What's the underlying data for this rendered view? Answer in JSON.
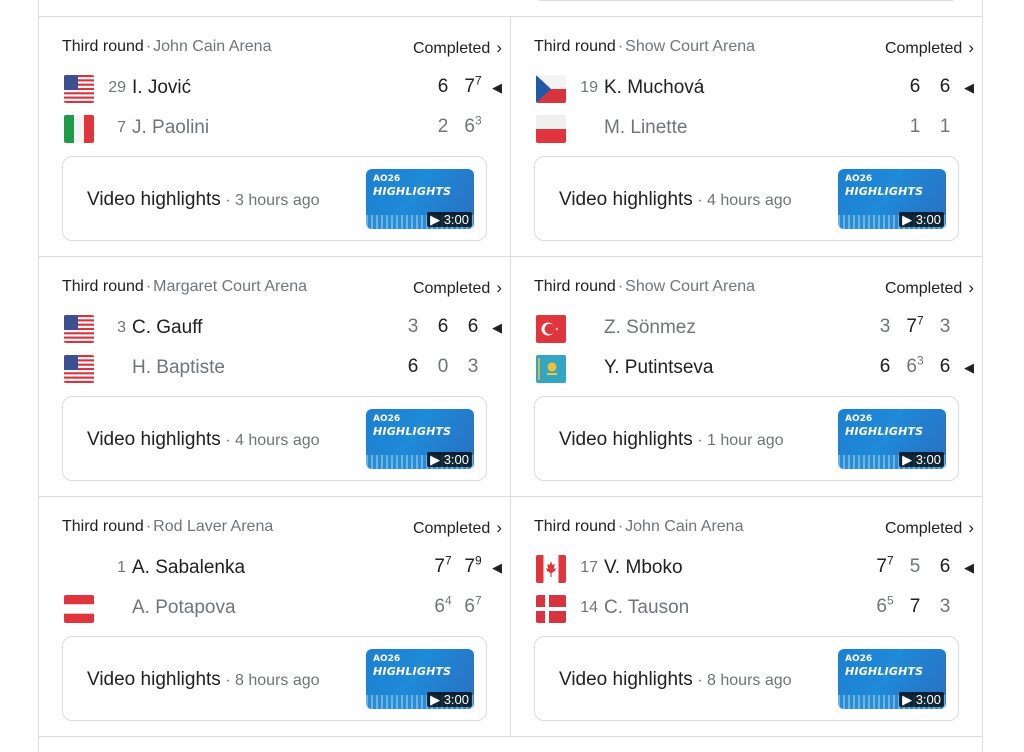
{
  "matches": [
    {
      "round": "Third round",
      "venue": "John Cain Arena",
      "status": "Completed",
      "players": [
        {
          "flag": "us",
          "seed": "29",
          "name": "I. Jović",
          "winner": true,
          "sets": [
            {
              "score": "6",
              "tb": "",
              "won": true
            },
            {
              "score": "7",
              "tb": "7",
              "won": true
            }
          ]
        },
        {
          "flag": "it",
          "seed": "7",
          "name": "J. Paolini",
          "winner": false,
          "sets": [
            {
              "score": "2",
              "tb": "",
              "won": false
            },
            {
              "score": "6",
              "tb": "3",
              "won": false
            }
          ]
        }
      ],
      "video": {
        "label": "Video highlights",
        "time": "3 hours ago",
        "duration": "3:00",
        "thumb_brand": "AO26",
        "thumb_title": "HIGHLIGHTS"
      }
    },
    {
      "round": "Third round",
      "venue": "Show Court Arena",
      "status": "Completed",
      "players": [
        {
          "flag": "cz",
          "seed": "19",
          "name": "K. Muchová",
          "winner": true,
          "sets": [
            {
              "score": "6",
              "tb": "",
              "won": true
            },
            {
              "score": "6",
              "tb": "",
              "won": true
            }
          ]
        },
        {
          "flag": "pl",
          "seed": "",
          "name": "M. Linette",
          "winner": false,
          "sets": [
            {
              "score": "1",
              "tb": "",
              "won": false
            },
            {
              "score": "1",
              "tb": "",
              "won": false
            }
          ]
        }
      ],
      "video": {
        "label": "Video highlights",
        "time": "4 hours ago",
        "duration": "3:00",
        "thumb_brand": "AO26",
        "thumb_title": "HIGHLIGHTS"
      }
    },
    {
      "round": "Third round",
      "venue": "Margaret Court Arena",
      "status": "Completed",
      "players": [
        {
          "flag": "us",
          "seed": "3",
          "name": "C. Gauff",
          "winner": true,
          "sets": [
            {
              "score": "3",
              "tb": "",
              "won": false
            },
            {
              "score": "6",
              "tb": "",
              "won": true
            },
            {
              "score": "6",
              "tb": "",
              "won": true
            }
          ]
        },
        {
          "flag": "us",
          "seed": "",
          "name": "H. Baptiste",
          "winner": false,
          "sets": [
            {
              "score": "6",
              "tb": "",
              "won": true
            },
            {
              "score": "0",
              "tb": "",
              "won": false
            },
            {
              "score": "3",
              "tb": "",
              "won": false
            }
          ]
        }
      ],
      "video": {
        "label": "Video highlights",
        "time": "4 hours ago",
        "duration": "3:00",
        "thumb_brand": "AO26",
        "thumb_title": "HIGHLIGHTS"
      }
    },
    {
      "round": "Third round",
      "venue": "Show Court Arena",
      "status": "Completed",
      "players": [
        {
          "flag": "tr",
          "seed": "",
          "name": "Z. Sönmez",
          "winner": false,
          "sets": [
            {
              "score": "3",
              "tb": "",
              "won": false
            },
            {
              "score": "7",
              "tb": "7",
              "won": true
            },
            {
              "score": "3",
              "tb": "",
              "won": false
            }
          ]
        },
        {
          "flag": "kz",
          "seed": "",
          "name": "Y. Putintseva",
          "winner": true,
          "sets": [
            {
              "score": "6",
              "tb": "",
              "won": true
            },
            {
              "score": "6",
              "tb": "3",
              "won": false
            },
            {
              "score": "6",
              "tb": "",
              "won": true
            }
          ]
        }
      ],
      "video": {
        "label": "Video highlights",
        "time": "1 hour ago",
        "duration": "3:00",
        "thumb_brand": "AO26",
        "thumb_title": "HIGHLIGHTS"
      }
    },
    {
      "round": "Third round",
      "venue": "Rod Laver Arena",
      "status": "Completed",
      "players": [
        {
          "flag": "",
          "seed": "1",
          "name": "A. Sabalenka",
          "winner": true,
          "sets": [
            {
              "score": "7",
              "tb": "7",
              "won": true
            },
            {
              "score": "7",
              "tb": "9",
              "won": true
            }
          ]
        },
        {
          "flag": "at",
          "seed": "",
          "name": "A. Potapova",
          "winner": false,
          "sets": [
            {
              "score": "6",
              "tb": "4",
              "won": false
            },
            {
              "score": "6",
              "tb": "7",
              "won": false
            }
          ]
        }
      ],
      "video": {
        "label": "Video highlights",
        "time": "8 hours ago",
        "duration": "3:00",
        "thumb_brand": "AO26",
        "thumb_title": "HIGHLIGHTS"
      }
    },
    {
      "round": "Third round",
      "venue": "John Cain Arena",
      "status": "Completed",
      "players": [
        {
          "flag": "ca",
          "seed": "17",
          "name": "V. Mboko",
          "winner": true,
          "sets": [
            {
              "score": "7",
              "tb": "7",
              "won": true
            },
            {
              "score": "5",
              "tb": "",
              "won": false
            },
            {
              "score": "6",
              "tb": "",
              "won": true
            }
          ]
        },
        {
          "flag": "dk",
          "seed": "14",
          "name": "C. Tauson",
          "winner": false,
          "sets": [
            {
              "score": "6",
              "tb": "5",
              "won": false
            },
            {
              "score": "7",
              "tb": "",
              "won": true
            },
            {
              "score": "3",
              "tb": "",
              "won": false
            }
          ]
        }
      ],
      "video": {
        "label": "Video highlights",
        "time": "8 hours ago",
        "duration": "3:00",
        "thumb_brand": "AO26",
        "thumb_title": "HIGHLIGHTS"
      }
    }
  ],
  "colors": {
    "border": "#dadce0",
    "text": "#202124",
    "muted": "#70757a",
    "thumb_blue": "#1e8ad8"
  }
}
